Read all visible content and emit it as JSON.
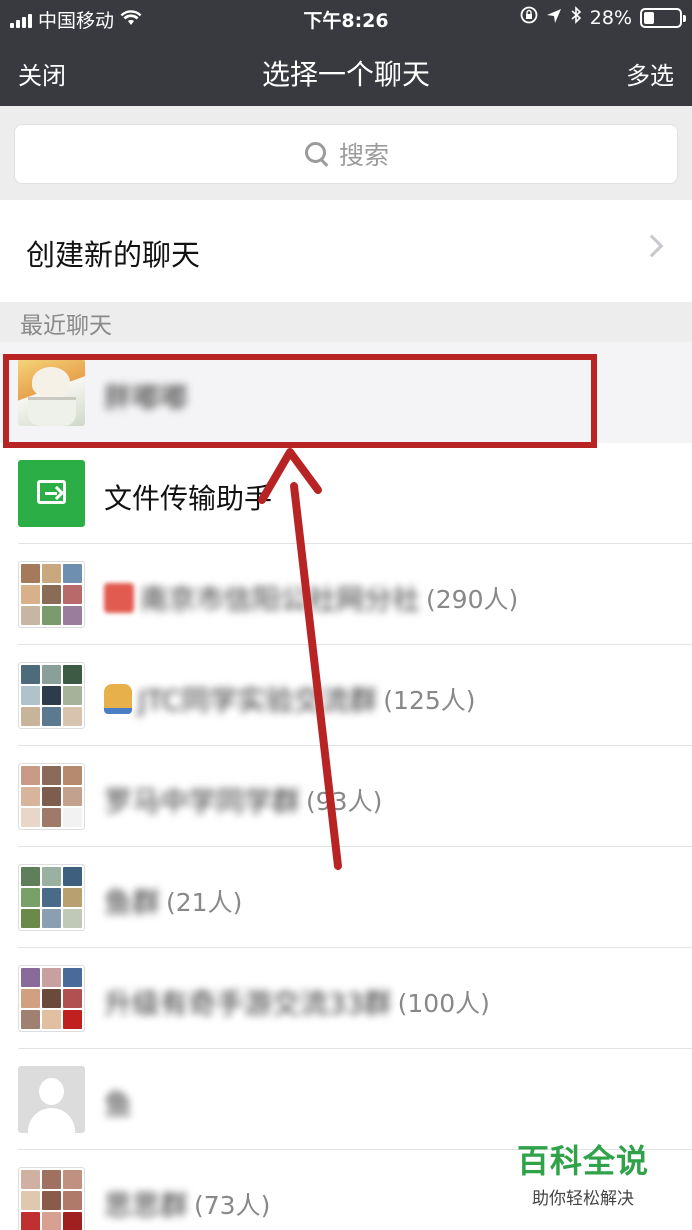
{
  "status_bar": {
    "carrier": "中国移动",
    "time": "下午8:26",
    "battery_percent": "28%",
    "battery_level": 0.28
  },
  "nav": {
    "close_label": "关闭",
    "title": "选择一个聊天",
    "multi_select_label": "多选"
  },
  "search": {
    "placeholder": "搜索"
  },
  "new_chat": {
    "label": "创建新的聊天"
  },
  "recent_header": "最近聊天",
  "chats": [
    {
      "name": "胖嘟嘟",
      "count": "",
      "avatar": "cat-avatar",
      "highlighted": true
    },
    {
      "name": "文件传输助手",
      "count": "",
      "avatar": "file-transfer-icon",
      "highlighted": false
    },
    {
      "name": "南京市信阳公社网分社",
      "count": "(290人)",
      "avatar": "group-avatar",
      "highlighted": false
    },
    {
      "name": "JTC同学实验交流群",
      "count": "(125人)",
      "avatar": "group-avatar",
      "highlighted": false
    },
    {
      "name": "罗马中学同学群",
      "count": "(93人)",
      "avatar": "group-avatar",
      "highlighted": false
    },
    {
      "name": "鱼群",
      "count": "(21人)",
      "avatar": "group-avatar",
      "highlighted": false
    },
    {
      "name": "升级有奇手游交流33群",
      "count": "(100人)",
      "avatar": "group-avatar",
      "highlighted": false
    },
    {
      "name": "鱼",
      "count": "",
      "avatar": "default-avatar",
      "highlighted": false
    },
    {
      "name": "思思群",
      "count": "(73人)",
      "avatar": "group-avatar",
      "highlighted": false
    }
  ],
  "watermark": {
    "brand": "百科全说",
    "slogan": "助你轻松解决"
  },
  "colors": {
    "navbar_bg": "#393a3f",
    "accent_green": "#2aae45",
    "annotation_red": "#b82424"
  }
}
